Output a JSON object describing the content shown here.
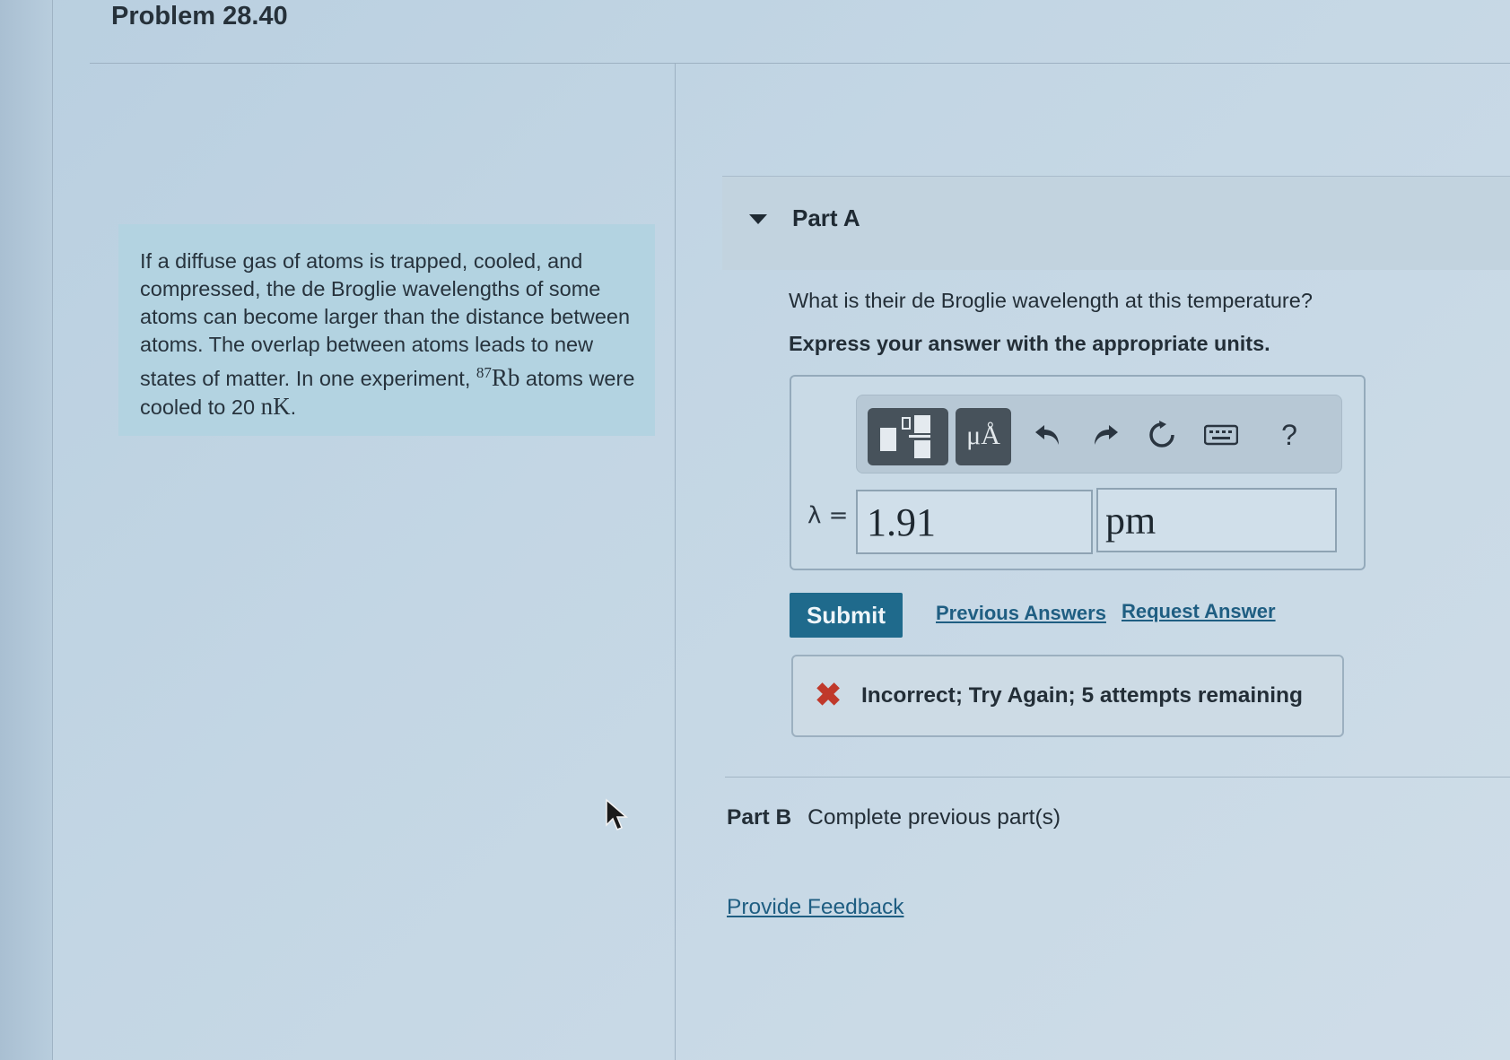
{
  "problem": {
    "title": "Problem 28.40",
    "text_part1": "If a diffuse gas of atoms is trapped, cooled, and compressed, the de Broglie wavelengths of some atoms can become larger than the distance between atoms. The overlap between atoms leads to new states of matter. In one experiment, ",
    "isotope_mass": "87",
    "isotope_symbol": "Rb",
    "text_part2": " atoms were cooled to 20 ",
    "temperature_unit": "nK",
    "text_part3": "."
  },
  "part_a": {
    "label": "Part A",
    "question": "What is their de Broglie wavelength at this temperature?",
    "instruction": "Express your answer with the appropriate units.",
    "toolbar": {
      "units_label": "μÅ",
      "undo_icon": "undo-icon",
      "redo_icon": "redo-icon",
      "reset_icon": "reset-icon",
      "keyboard_icon": "keyboard-icon",
      "help_label": "?"
    },
    "variable_label": "λ =",
    "value": "1.91",
    "unit": "pm",
    "submit_label": "Submit",
    "previous_answers_label": "Previous Answers",
    "request_answer_label": "Request Answer",
    "feedback": "Incorrect; Try Again; 5 attempts remaining",
    "feedback_color": "#c0392b"
  },
  "part_b": {
    "label": "Part B",
    "status": "Complete previous part(s)"
  },
  "footer": {
    "provide_feedback_label": "Provide Feedback"
  }
}
